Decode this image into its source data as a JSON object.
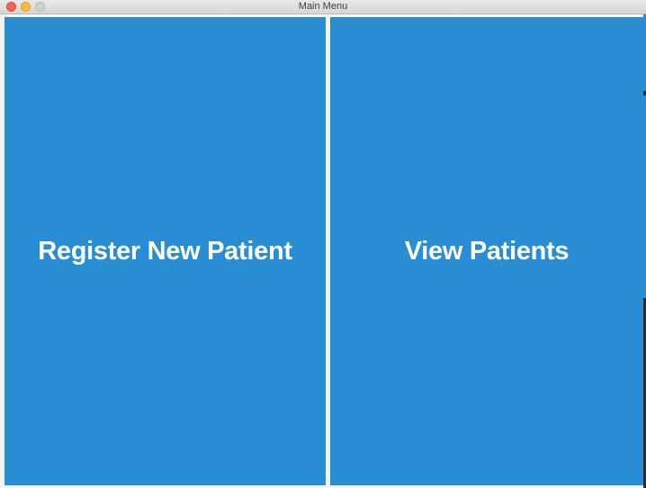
{
  "window": {
    "title": "Main Menu"
  },
  "menu": {
    "register_label": "Register New Patient",
    "view_label": "View Patients"
  },
  "colors": {
    "button_blue": "#288dd3",
    "button_text": "#ffffff",
    "close": "#fc5f57",
    "minimize": "#fdbc2e",
    "maximize_disabled": "#d0d0d0"
  }
}
